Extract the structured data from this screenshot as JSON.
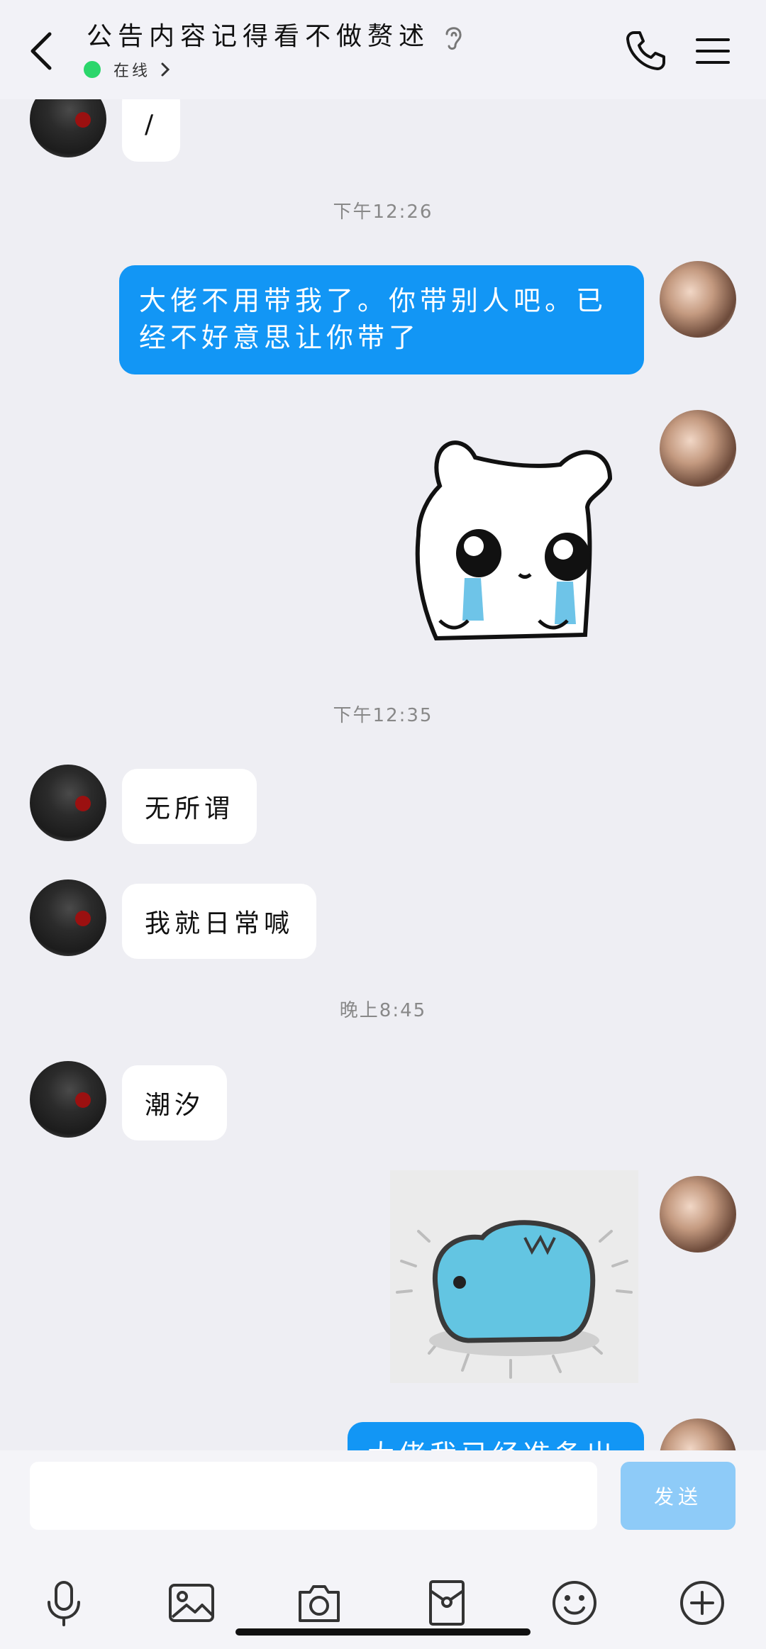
{
  "header": {
    "title": "公告内容记得看不做赘述",
    "status": "在线"
  },
  "messages": {
    "m0": "/",
    "t1": "下午12:26",
    "m1": "大佬不用带我了。你带别人吧。已经不好意思让你带了",
    "t2": "下午12:35",
    "m2": "无所谓",
    "m3": "我就日常喊",
    "t3": "晚上8:45",
    "m4": "潮汐",
    "m5": "大佬我已经准备出行"
  },
  "input": {
    "placeholder": "",
    "send_label": "发送"
  },
  "toolbar": {
    "icons": [
      "microphone-icon",
      "image-icon",
      "camera-icon",
      "red-packet-icon",
      "emoji-icon",
      "plus-icon"
    ]
  },
  "colors": {
    "accent": "#1296F5",
    "online": "#2BD66B",
    "send_disabled": "#8ECBF8"
  }
}
